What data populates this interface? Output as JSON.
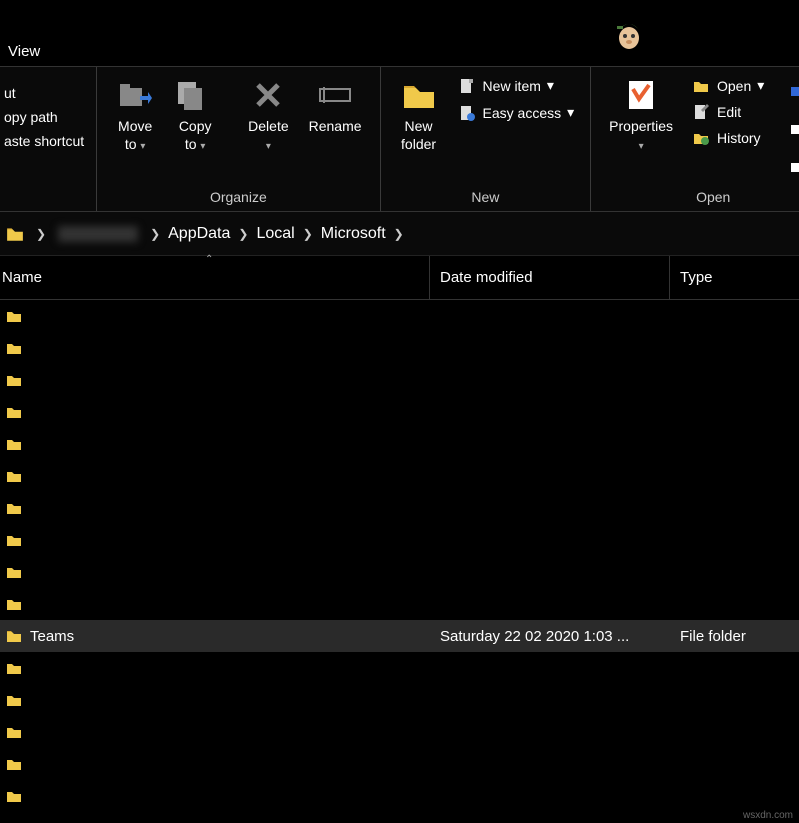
{
  "tabs": {
    "view": "View"
  },
  "ribbon": {
    "clipboard": {
      "cut": "ut",
      "copy_path": "opy path",
      "paste_shortcut": "aste shortcut"
    },
    "organize": {
      "move_to": "Move",
      "move_to2": "to",
      "caret": "▾",
      "copy_to": "Copy",
      "copy_to2": "to",
      "delete": "Delete",
      "rename": "Rename",
      "label": "Organize"
    },
    "new": {
      "new_folder": "New",
      "new_folder2": "folder",
      "new_item": "New item",
      "easy_access": "Easy access",
      "label": "New"
    },
    "open": {
      "properties": "Properties",
      "open": "Open",
      "edit": "Edit",
      "history": "History",
      "label": "Open"
    }
  },
  "breadcrumb": {
    "seg1": "AppData",
    "seg2": "Local",
    "seg3": "Microsoft"
  },
  "columns": {
    "name": "Name",
    "date": "Date modified",
    "type": "Type"
  },
  "files": {
    "teams": {
      "name": "Teams",
      "date": "Saturday 22 02 2020 1:03 ...",
      "type": "File folder"
    }
  },
  "watermark": "wsxdn.com"
}
